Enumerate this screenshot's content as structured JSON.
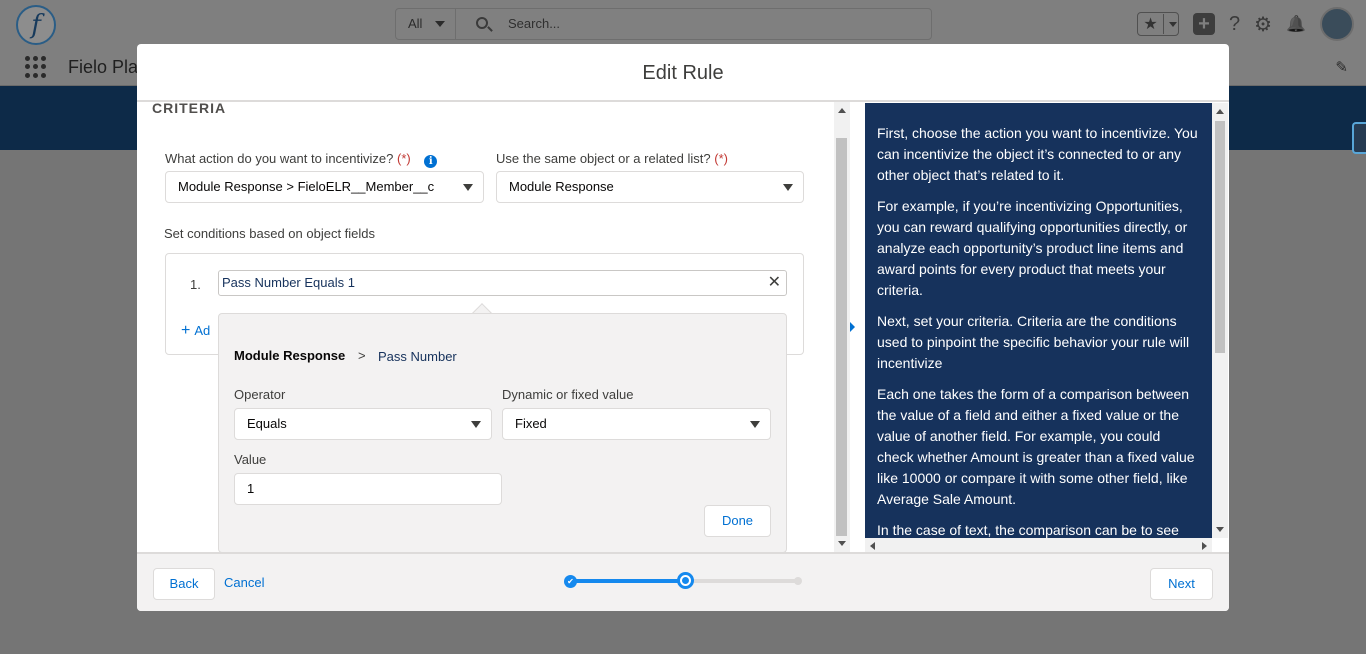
{
  "app": {
    "logo_letter": "f",
    "search_scope": "All",
    "search_placeholder": "Search...",
    "favorites_star": "★",
    "add_icon": "+",
    "help_icon": "?",
    "settings_icon": "⚙",
    "bell_icon": "🔔",
    "app_name": "Fielo Pla",
    "edit_icon": "✎"
  },
  "modal": {
    "title": "Edit Rule",
    "section_title": "CRITERIA",
    "action_label": "What action do you want to incentivize?",
    "required_marker": "(*)",
    "info_glyph": "i",
    "action_value": "Module Response > FieloELR__Member__c",
    "object_label": "Use the same object or a related list?",
    "object_value": "Module Response",
    "conditions_label": "Set conditions based on object fields",
    "condition": {
      "index": "1.",
      "summary": "Pass Number Equals 1",
      "remove_glyph": "✕",
      "add_glyph": "+",
      "add_label": "Ad"
    },
    "popover": {
      "object": "Module Response",
      "separator": ">",
      "field": "Pass Number",
      "operator_label": "Operator",
      "operator_value": "Equals",
      "mode_label": "Dynamic or fixed value",
      "mode_value": "Fixed",
      "value_label": "Value",
      "value": "1",
      "done_label": "Done"
    },
    "help": [
      "First, choose the action you want to incentivize. You can incentivize the object it’s connected to or any other object that’s related to it.",
      "For example, if you’re incentivizing Opportunities, you can reward qualifying opportunities directly, or analyze each opportunity’s product line items and award points for every product that meets your criteria.",
      "Next, set your criteria. Criteria are the conditions used to pinpoint the specific behavior your rule will incentivize",
      "Each one takes the form of a comparison between the value of a field and either a fixed value or the value of another field. For example, you could check whether Amount is greater than a fixed value like 10000 or compare it with some other field, like Average Sale Amount.",
      "In the case of text, the comparison can be to see"
    ],
    "footer": {
      "back_label": "Back",
      "cancel_label": "Cancel",
      "next_label": "Next",
      "progress": {
        "current_step": 2,
        "total_steps": 3
      },
      "check_glyph": "✔"
    }
  },
  "colors": {
    "brand": "#0070d2",
    "help_bg": "#16325c",
    "progress": "#1589ee",
    "required": "#c23934"
  }
}
